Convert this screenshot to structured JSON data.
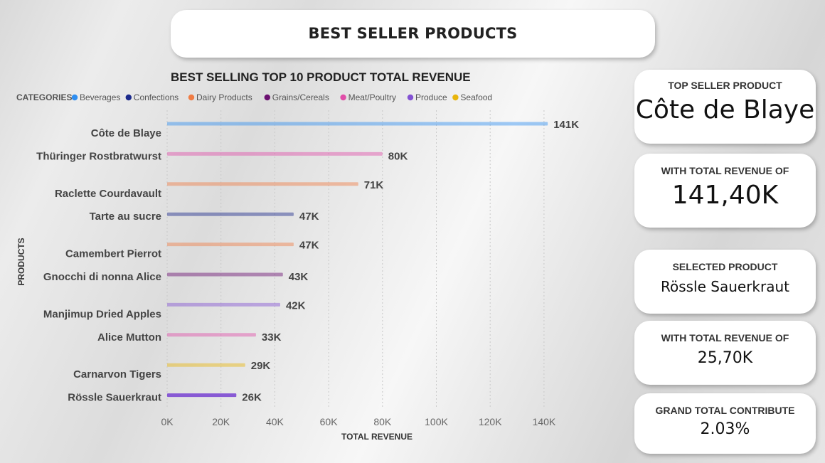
{
  "header": {
    "title": "BEST SELLER PRODUCTS"
  },
  "kpis": {
    "top_seller_label": "TOP SELLER PRODUCT",
    "top_seller_value": "Côte de Blaye",
    "top_revenue_label": "WITH TOTAL REVENUE OF",
    "top_revenue_value": "141,40K",
    "selected_label": "SELECTED PRODUCT",
    "selected_value": "Rössle Sauerkraut",
    "selected_revenue_label": "WITH TOTAL REVENUE OF",
    "selected_revenue_value": "25,70K",
    "grand_total_label": "GRAND TOTAL CONTRIBUTE",
    "grand_total_value": "2.03%"
  },
  "colors": {
    "Beverages": "#2f8ef0",
    "Confections": "#1c2a8c",
    "Dairy Products": "#f07d45",
    "Grains/Cereals": "#6b1070",
    "Meat/Poultry": "#e04ea8",
    "Produce": "#8352d3",
    "Seafood": "#e8b50c"
  },
  "chart_data": {
    "type": "bar",
    "orientation": "horizontal",
    "title": "BEST SELLING TOP 10 PRODUCT TOTAL REVENUE",
    "xlabel": "TOTAL REVENUE",
    "ylabel": "PRODUCTS",
    "legend_title": "CATEGORIES",
    "legend_position": "top-left",
    "legend": [
      "Beverages",
      "Confections",
      "Dairy Products",
      "Grains/Cereals",
      "Meat/Poultry",
      "Produce",
      "Seafood"
    ],
    "xlim": [
      0,
      145000
    ],
    "x_ticks": [
      "0K",
      "20K",
      "40K",
      "60K",
      "80K",
      "100K",
      "120K",
      "140K"
    ],
    "grid": true,
    "categories": [
      "Côte de Blaye",
      "Thüringer Rostbratwurst",
      "Raclette Courdavault",
      "Tarte au sucre",
      "Camembert Pierrot",
      "Gnocchi di nonna Alice",
      "Manjimup Dried Apples",
      "Alice Mutton",
      "Carnarvon Tigers",
      "Rössle Sauerkraut"
    ],
    "values": [
      141400,
      80000,
      71000,
      47000,
      47000,
      43000,
      42000,
      33000,
      29000,
      25700
    ],
    "labels": [
      "141K",
      "80K",
      "71K",
      "47K",
      "47K",
      "43K",
      "42K",
      "33K",
      "29K",
      "26K"
    ],
    "series_category": [
      "Beverages",
      "Meat/Poultry",
      "Dairy Products",
      "Confections",
      "Dairy Products",
      "Grains/Cereals",
      "Produce",
      "Meat/Poultry",
      "Seafood",
      "Produce"
    ],
    "selected": "Rössle Sauerkraut"
  }
}
